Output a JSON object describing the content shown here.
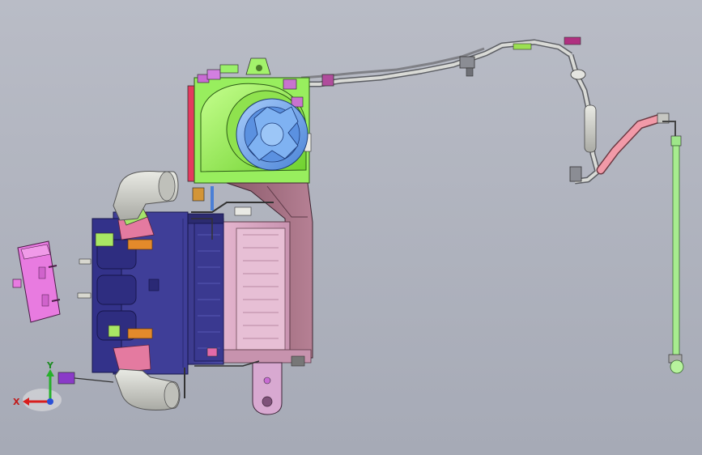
{
  "scene": {
    "triad": {
      "x_label": "X",
      "y_label": "Y"
    },
    "colors": {
      "background_top": "#b9bcc6",
      "background_bottom": "#a6aab6",
      "blower_green": "#9df25a",
      "fan_blue": "#6aa5ef",
      "heater_navy": "#3d3c8f",
      "evaporator_pink": "#d9a3be",
      "connector_magenta": "#e87be0",
      "hose_salmon": "#f08c9c",
      "tube_green": "#9ee689",
      "duct_gray": "#d2d3cd"
    }
  }
}
